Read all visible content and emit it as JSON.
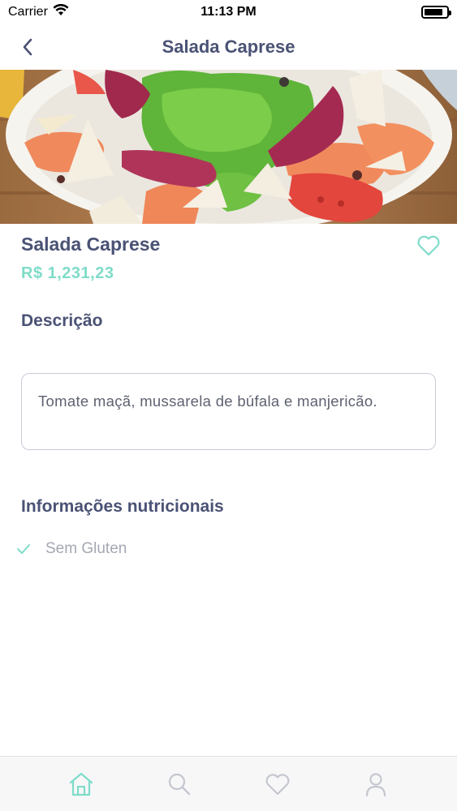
{
  "status_bar": {
    "carrier": "Carrier",
    "time": "11:13 PM",
    "battery_level": 0.85
  },
  "nav": {
    "title": "Salada Caprese",
    "back_icon": "chevron-left-icon"
  },
  "product": {
    "name": "Salada Caprese",
    "price": "R$ 1,231,23",
    "favorite_icon": "heart-icon"
  },
  "description": {
    "title": "Descrição",
    "text": "Tomate maçã, mussarela de búfala e manjericão."
  },
  "nutrition": {
    "title": "Informações nutricionais",
    "items": [
      {
        "label": "Sem Gluten",
        "icon": "check-icon"
      }
    ]
  },
  "tab_bar": {
    "tabs": [
      {
        "icon": "home-icon",
        "active": true
      },
      {
        "icon": "search-icon",
        "active": false
      },
      {
        "icon": "heart-icon",
        "active": false
      },
      {
        "icon": "user-icon",
        "active": false
      }
    ]
  },
  "colors": {
    "primary_text": "#4a5275",
    "accent": "#7fdcc9",
    "muted": "#a5a8b3",
    "tab_inactive": "#c4c7cf"
  }
}
